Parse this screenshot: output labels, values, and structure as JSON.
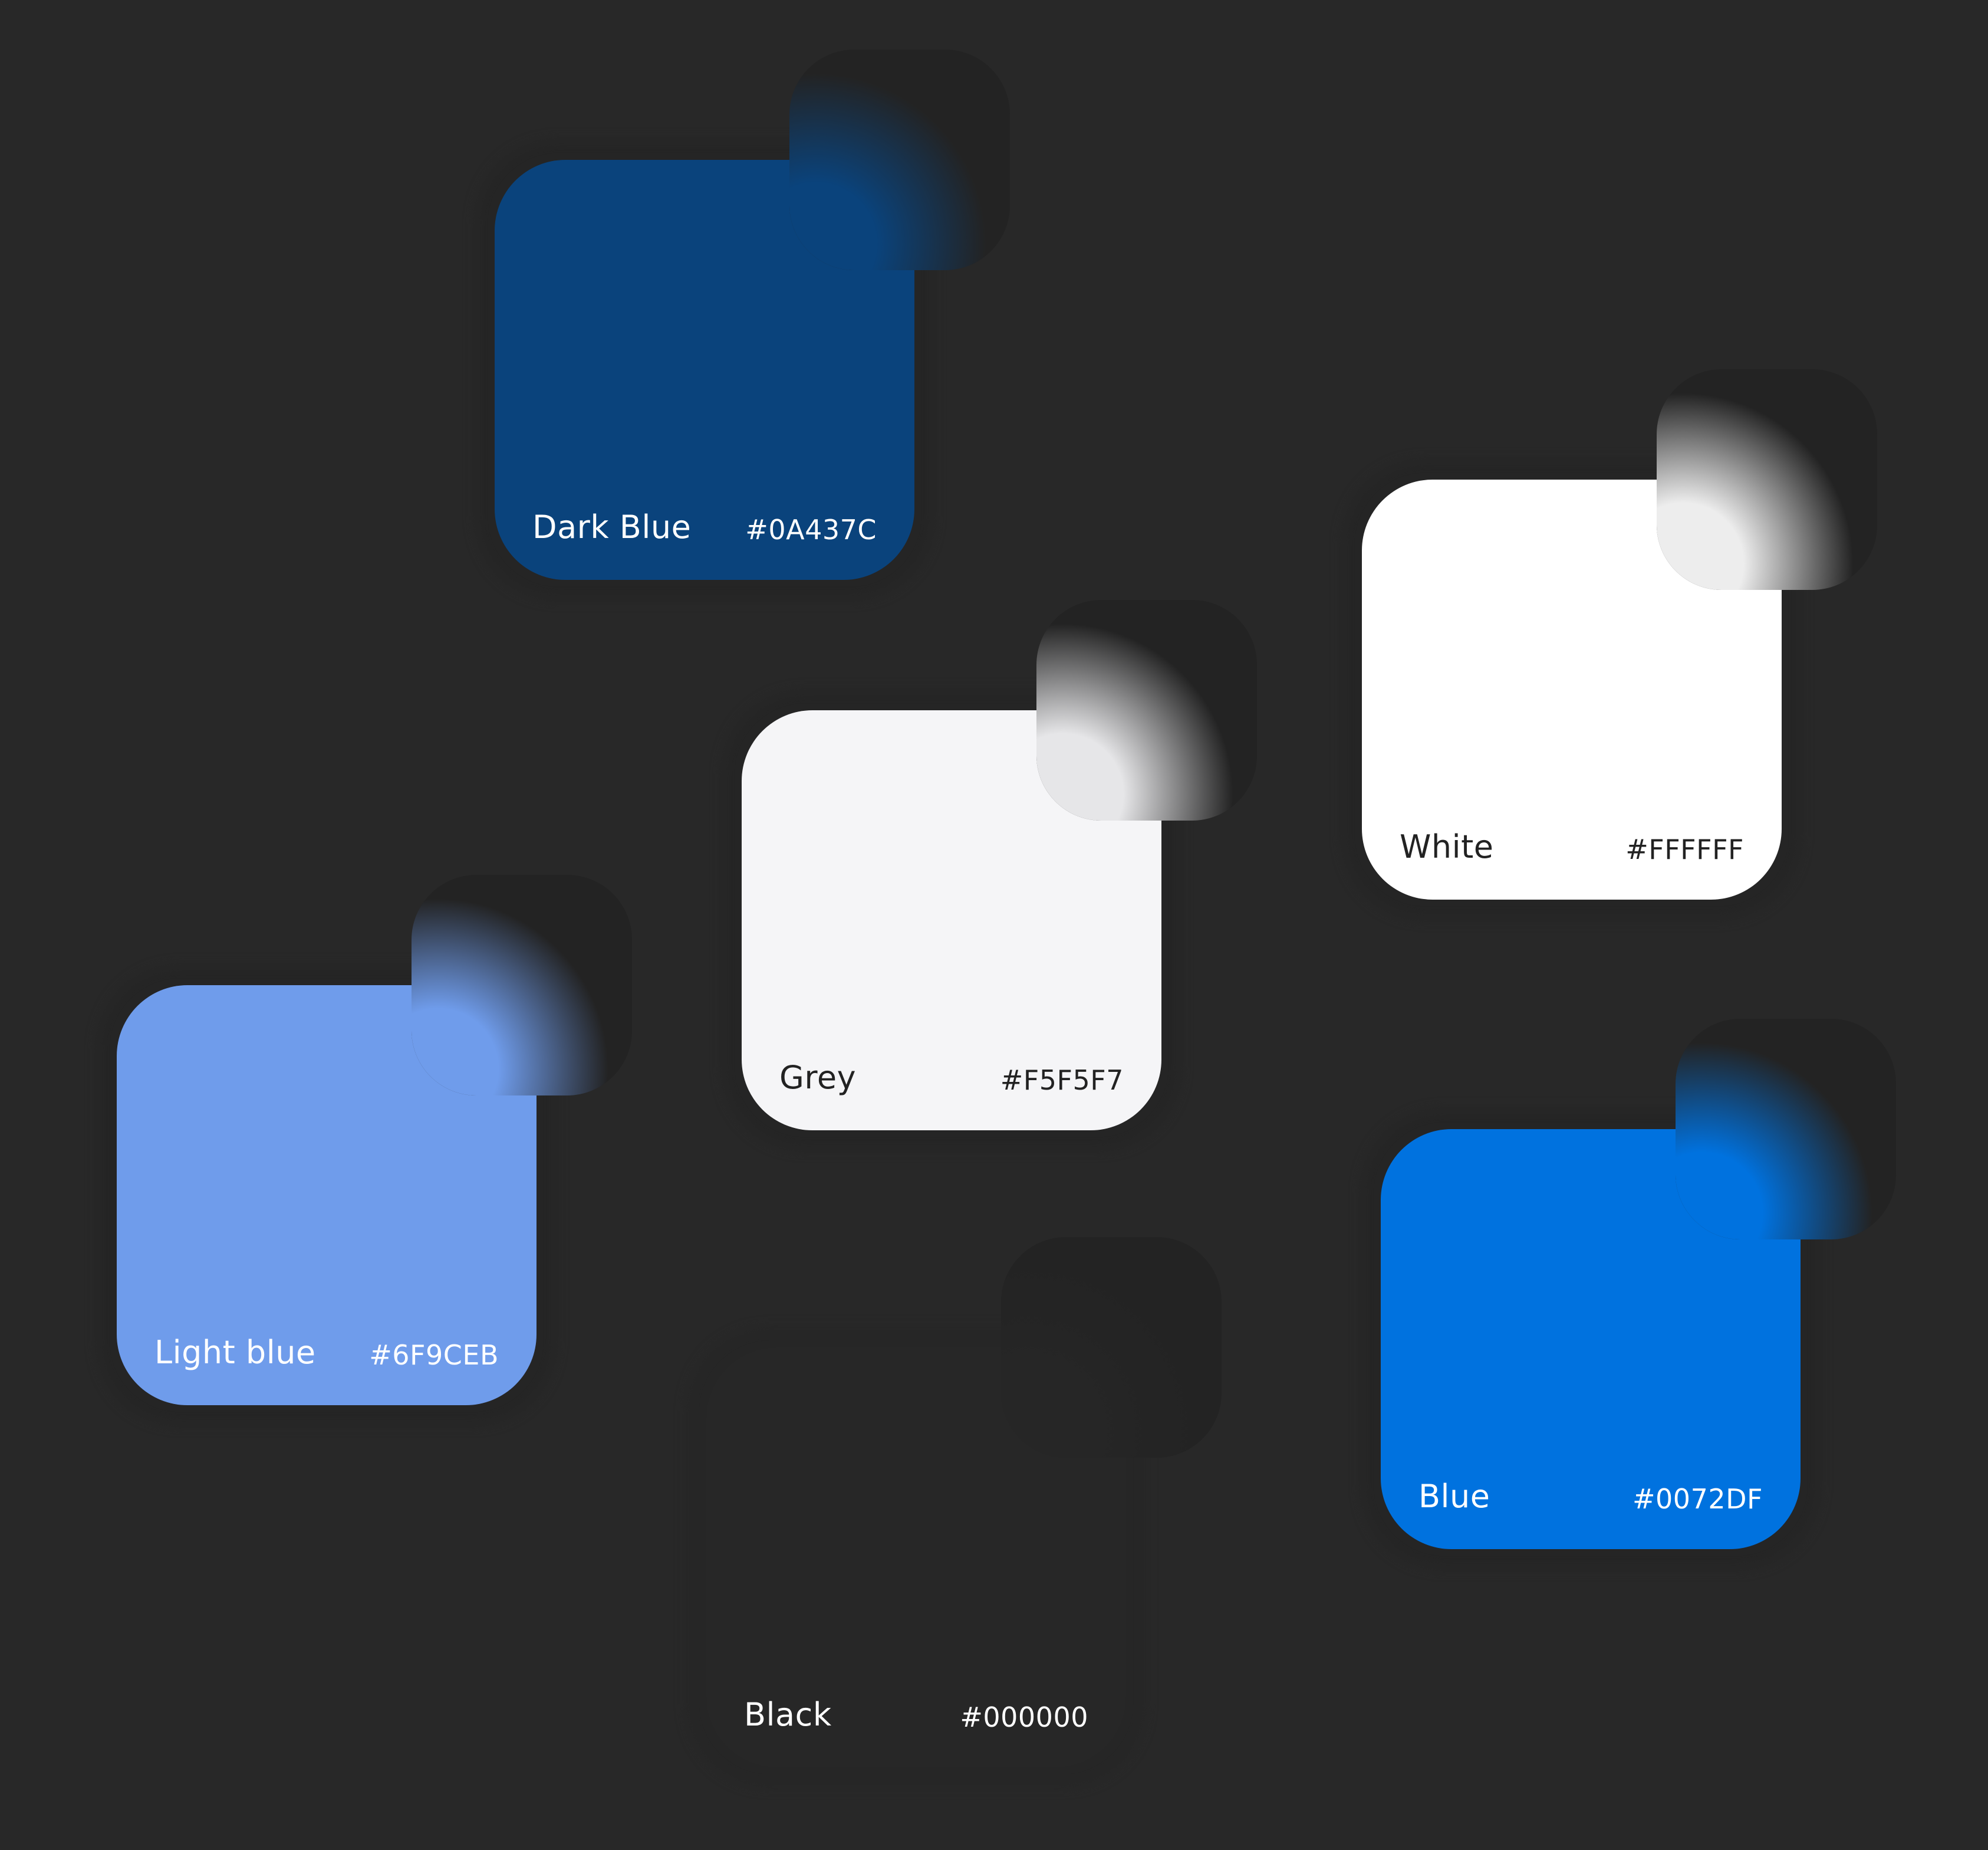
{
  "swatches": [
    {
      "name": "Dark Blue",
      "hex": "#0A437C",
      "fill": "#0A437C",
      "text_color": "#FFFFFF",
      "glow": "#0A437C"
    },
    {
      "name": "White",
      "hex": "#FFFFFF",
      "fill": "#FFFFFF",
      "text_color": "#222222",
      "glow": "#EDEDED"
    },
    {
      "name": "Grey",
      "hex": "#F5F5F7",
      "fill": "#F5F5F7",
      "text_color": "#222222",
      "glow": "#E6E6E8"
    },
    {
      "name": "Light blue",
      "hex": "#6F9CEB",
      "fill": "#6F9CEB",
      "text_color": "#FFFFFF",
      "glow": "#6F9CEB"
    },
    {
      "name": "Blue",
      "hex": "#0072DF",
      "fill": "#0072DF",
      "text_color": "#FFFFFF",
      "glow": "#0072DF"
    },
    {
      "name": "Black",
      "hex": "#000000",
      "fill": "#272727",
      "text_color": "#FFFFFF",
      "glow": "#262626"
    }
  ],
  "background": "#282828"
}
